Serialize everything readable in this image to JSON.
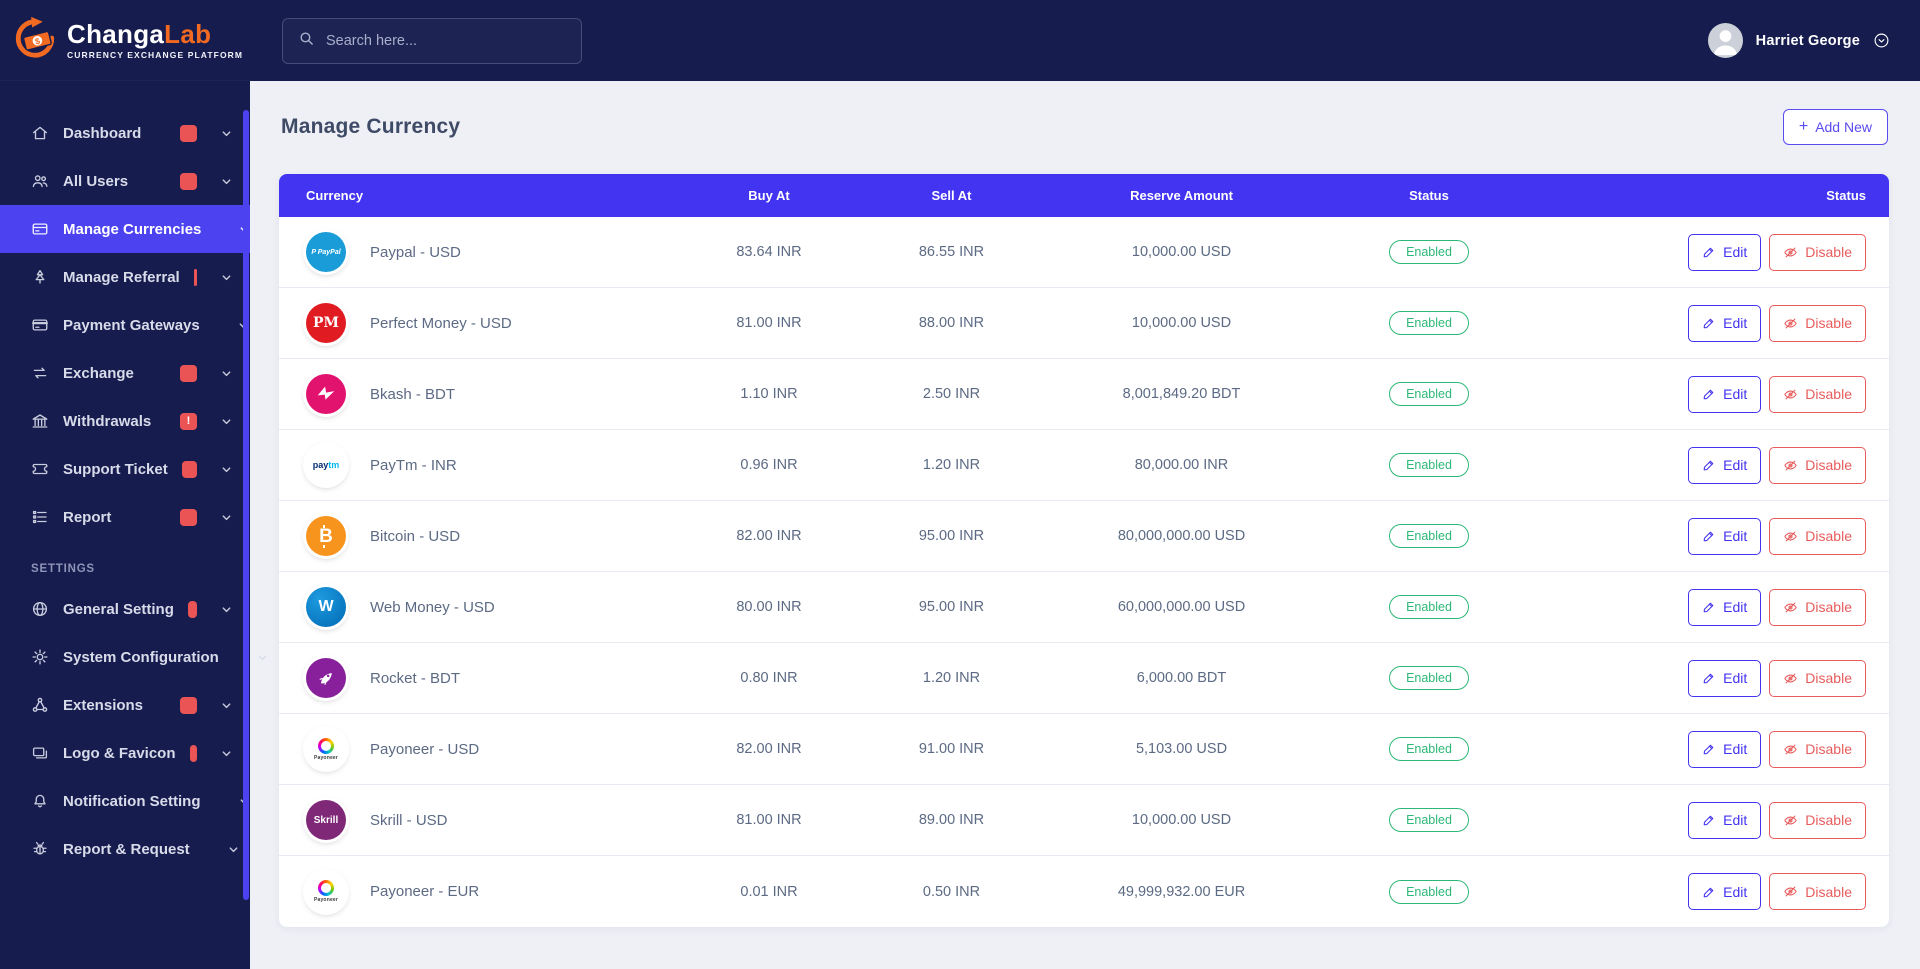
{
  "brand": {
    "name_primary": "Changa",
    "name_secondary": "Lab",
    "tagline": "CURRENCY EXCHANGE PLATFORM"
  },
  "topbar": {
    "search_placeholder": "Search here...",
    "user_name": "Harriet George"
  },
  "sidebar": {
    "items": [
      {
        "label": "Dashboard",
        "icon": "home",
        "active": false,
        "chevron": false
      },
      {
        "label": "All Users",
        "icon": "users",
        "active": false,
        "chevron": false
      },
      {
        "label": "Manage Currencies",
        "icon": "wallet",
        "active": true,
        "chevron": false
      },
      {
        "label": "Manage Referral",
        "icon": "referral",
        "active": false,
        "chevron": false
      },
      {
        "label": "Payment Gateways",
        "icon": "card",
        "active": false,
        "chevron": false
      },
      {
        "label": "Exchange",
        "icon": "exchange",
        "active": false,
        "chevron": true
      },
      {
        "label": "Withdrawals",
        "icon": "bank",
        "active": false,
        "chevron": true,
        "badge": "!"
      },
      {
        "label": "Support Ticket",
        "icon": "ticket",
        "active": false,
        "chevron": true
      },
      {
        "label": "Report",
        "icon": "report",
        "active": false,
        "chevron": true
      }
    ],
    "section_label": "SETTINGS",
    "settings_items": [
      {
        "label": "General Setting",
        "icon": "globe",
        "active": false,
        "chevron": false
      },
      {
        "label": "System Configuration",
        "icon": "gear",
        "active": false,
        "chevron": false
      },
      {
        "label": "Extensions",
        "icon": "extensions",
        "active": false,
        "chevron": false
      },
      {
        "label": "Logo & Favicon",
        "icon": "image",
        "active": false,
        "chevron": false
      },
      {
        "label": "Notification Setting",
        "icon": "bell",
        "active": false,
        "chevron": true
      },
      {
        "label": "Report & Request",
        "icon": "bug",
        "active": false,
        "chevron": false
      }
    ]
  },
  "main": {
    "title": "Manage Currency",
    "add_button": {
      "plus": "+",
      "label": "Add New"
    },
    "table": {
      "headers": [
        "Currency",
        "Buy At",
        "Sell At",
        "Reserve Amount",
        "Status",
        "Status"
      ],
      "actions": {
        "edit": "Edit",
        "disable": "Disable"
      },
      "rows": [
        {
          "icon": "paypal",
          "name": "Paypal - USD",
          "buy": "83.64 INR",
          "sell": "86.55 INR",
          "reserve": "10,000.00 USD",
          "status": "Enabled"
        },
        {
          "icon": "perfect-money",
          "name": "Perfect Money - USD",
          "buy": "81.00 INR",
          "sell": "88.00 INR",
          "reserve": "10,000.00 USD",
          "status": "Enabled"
        },
        {
          "icon": "bkash",
          "name": "Bkash - BDT",
          "buy": "1.10 INR",
          "sell": "2.50 INR",
          "reserve": "8,001,849.20 BDT",
          "status": "Enabled"
        },
        {
          "icon": "paytm",
          "name": "PayTm - INR",
          "buy": "0.96 INR",
          "sell": "1.20 INR",
          "reserve": "80,000.00 INR",
          "status": "Enabled"
        },
        {
          "icon": "bitcoin",
          "name": "Bitcoin - USD",
          "buy": "82.00 INR",
          "sell": "95.00 INR",
          "reserve": "80,000,000.00 USD",
          "status": "Enabled"
        },
        {
          "icon": "webmoney",
          "name": "Web Money - USD",
          "buy": "80.00 INR",
          "sell": "95.00 INR",
          "reserve": "60,000,000.00 USD",
          "status": "Enabled"
        },
        {
          "icon": "rocket",
          "name": "Rocket - BDT",
          "buy": "0.80 INR",
          "sell": "1.20 INR",
          "reserve": "6,000.00 BDT",
          "status": "Enabled"
        },
        {
          "icon": "payoneer",
          "name": "Payoneer - USD",
          "buy": "82.00 INR",
          "sell": "91.00 INR",
          "reserve": "5,103.00 USD",
          "status": "Enabled"
        },
        {
          "icon": "skrill",
          "name": "Skrill - USD",
          "buy": "81.00 INR",
          "sell": "89.00 INR",
          "reserve": "10,000.00 USD",
          "status": "Enabled"
        },
        {
          "icon": "payoneer",
          "name": "Payoneer - EUR",
          "buy": "0.01 INR",
          "sell": "0.50 INR",
          "reserve": "49,999,932.00 EUR",
          "status": "Enabled"
        }
      ]
    }
  },
  "currency_icons": {
    "paypal": {
      "label": "PayPal",
      "bg": "#1a9cd8"
    },
    "perfect-money": {
      "label": "PM",
      "bg": "#e01b22"
    },
    "bkash": {
      "label": "",
      "bg": "#e2136e"
    },
    "paytm": {
      "label": "paytm",
      "bg": "#ffffff"
    },
    "bitcoin": {
      "label": "B",
      "bg": "#f7941d"
    },
    "webmoney": {
      "label": "W",
      "bg": "#0069b4"
    },
    "rocket": {
      "label": "",
      "bg": "#88209b"
    },
    "payoneer": {
      "label": "Payoneer",
      "bg": "#ffffff"
    },
    "skrill": {
      "label": "Skrill",
      "bg": "#7f2877"
    }
  },
  "colors": {
    "sidebar_bg": "#161c4e",
    "accent_blue": "#4334f1",
    "active_item_blue": "#4c42f0",
    "page_bg": "#eef0f6",
    "status_green": "#2eb877",
    "danger_red": "#e85c5c",
    "alert_badge_red": "#ea5455",
    "logo_orange": "#f26a21"
  }
}
